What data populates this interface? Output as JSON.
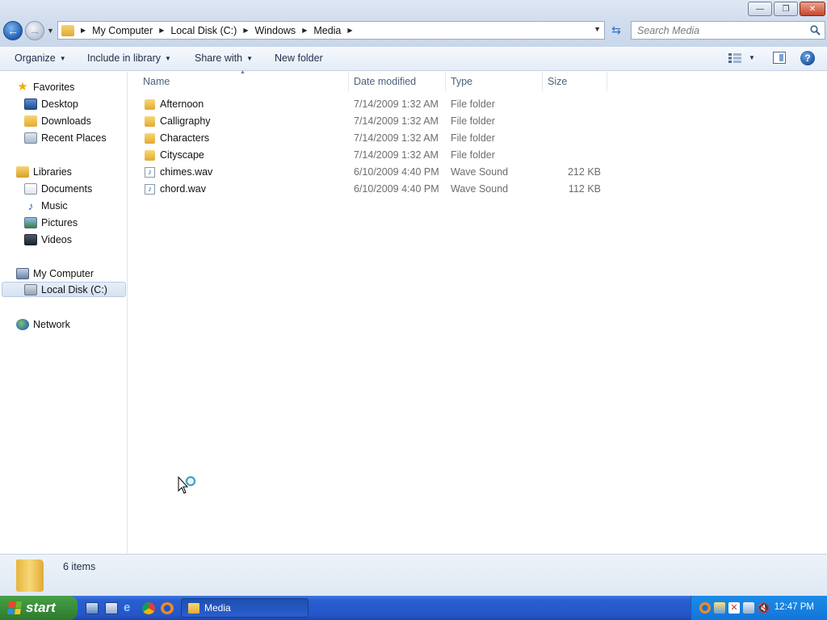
{
  "window": {
    "minimize_glyph": "—",
    "maximize_glyph": "❐",
    "close_glyph": "✕"
  },
  "address": {
    "crumbs": [
      "My Computer",
      "Local Disk (C:)",
      "Windows",
      "Media"
    ]
  },
  "search": {
    "placeholder": "Search Media"
  },
  "toolbar": {
    "organize": "Organize",
    "include_in_library": "Include in library",
    "share_with": "Share with",
    "new_folder": "New folder",
    "help_glyph": "?"
  },
  "sidebar": {
    "favorites": "Favorites",
    "desktop": "Desktop",
    "downloads": "Downloads",
    "recent_places": "Recent Places",
    "libraries": "Libraries",
    "documents": "Documents",
    "music": "Music",
    "pictures": "Pictures",
    "videos": "Videos",
    "my_computer": "My Computer",
    "local_disk": "Local Disk (C:)",
    "network": "Network"
  },
  "columns": {
    "name": "Name",
    "date_modified": "Date modified",
    "type": "Type",
    "size": "Size"
  },
  "files": [
    {
      "name": "Afternoon",
      "date": "7/14/2009 1:32 AM",
      "type": "File folder",
      "size": ""
    },
    {
      "name": "Calligraphy",
      "date": "7/14/2009 1:32 AM",
      "type": "File folder",
      "size": ""
    },
    {
      "name": "Characters",
      "date": "7/14/2009 1:32 AM",
      "type": "File folder",
      "size": ""
    },
    {
      "name": "Cityscape",
      "date": "7/14/2009 1:32 AM",
      "type": "File folder",
      "size": ""
    },
    {
      "name": "chimes.wav",
      "date": "6/10/2009 4:40 PM",
      "type": "Wave Sound",
      "size": "212 KB"
    },
    {
      "name": "chord.wav",
      "date": "6/10/2009 4:40 PM",
      "type": "Wave Sound",
      "size": "112 KB"
    }
  ],
  "details": {
    "item_count": "6 items"
  },
  "taskbar": {
    "start_label": "start",
    "task_label": "Media",
    "clock": "12:47 PM"
  },
  "colors": {
    "taskbar_blue": "#2556c8",
    "start_green": "#3a8e3a",
    "tray_blue": "#1375d8",
    "folder_yellow": "#e2aa33"
  }
}
